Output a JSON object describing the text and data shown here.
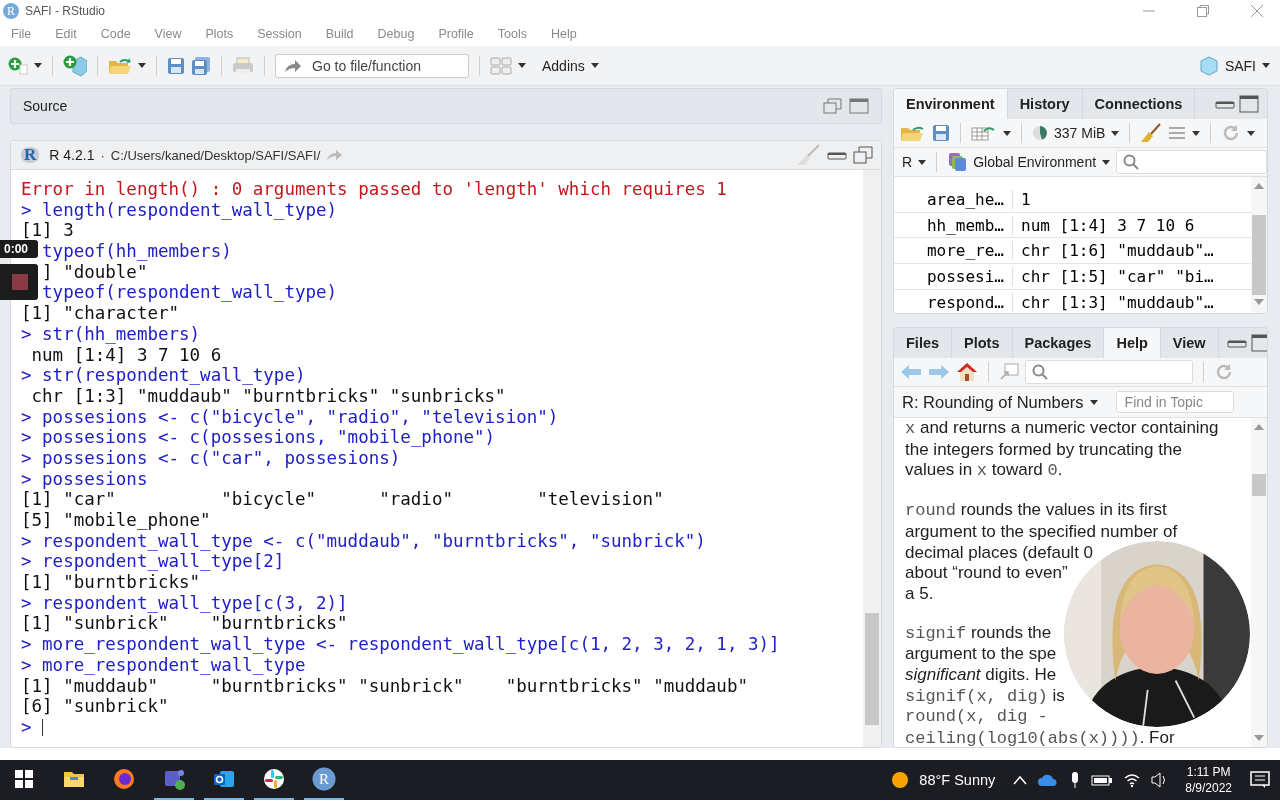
{
  "window": {
    "logo_letter": "R",
    "title": "SAFI - RStudio"
  },
  "menu": [
    "File",
    "Edit",
    "Code",
    "View",
    "Plots",
    "Session",
    "Build",
    "Debug",
    "Profile",
    "Tools",
    "Help"
  ],
  "toolbar": {
    "go_to_placeholder": "Go to file/function",
    "addins": "Addins",
    "project": "SAFI"
  },
  "source_pane": {
    "title": "Source"
  },
  "console": {
    "logo_letter": "R",
    "version": "R 4.2.1",
    "separator": "·",
    "path": "C:/Users/kaned/Desktop/SAFI/SAFI/",
    "lines": [
      {
        "kind": "error",
        "text": "Error in length() : 0 arguments passed to 'length' which requires 1"
      },
      {
        "kind": "input",
        "prompt": ">",
        "text": "length(respondent_wall_type)"
      },
      {
        "kind": "output",
        "text": "[1] 3"
      },
      {
        "kind": "input",
        "text": "typeof(hh_members)"
      },
      {
        "kind": "output_covered",
        "text": "] \"double\""
      },
      {
        "kind": "input",
        "text": "typeof(respondent_wall_type)"
      },
      {
        "kind": "output",
        "text": "[1] \"character\""
      },
      {
        "kind": "input",
        "prompt": ">",
        "text": "str(hh_members)"
      },
      {
        "kind": "output",
        "text": " num [1:4] 3 7 10 6"
      },
      {
        "kind": "input",
        "prompt": ">",
        "text": "str(respondent_wall_type)"
      },
      {
        "kind": "output",
        "text": " chr [1:3] \"muddaub\" \"burntbricks\" \"sunbricks\""
      },
      {
        "kind": "input",
        "prompt": ">",
        "text": "possesions <- c(\"bicycle\", \"radio\", \"television\")"
      },
      {
        "kind": "input",
        "prompt": ">",
        "text": "possesions <- c(possesions, \"mobile_phone\")"
      },
      {
        "kind": "input",
        "prompt": ">",
        "text": "possesions <- c(\"car\", possesions)"
      },
      {
        "kind": "input",
        "prompt": ">",
        "text": "possesions"
      },
      {
        "kind": "output",
        "text": "[1] \"car\"          \"bicycle\"      \"radio\"        \"television\""
      },
      {
        "kind": "output",
        "text": "[5] \"mobile_phone\""
      },
      {
        "kind": "input",
        "prompt": ">",
        "text": "respondent_wall_type <- c(\"muddaub\", \"burntbricks\", \"sunbrick\")"
      },
      {
        "kind": "input",
        "prompt": ">",
        "text": "respondent_wall_type[2]"
      },
      {
        "kind": "output",
        "text": "[1] \"burntbricks\""
      },
      {
        "kind": "input",
        "prompt": ">",
        "text": "respondent_wall_type[c(3, 2)]"
      },
      {
        "kind": "output",
        "text": "[1] \"sunbrick\"    \"burntbricks\""
      },
      {
        "kind": "input",
        "prompt": ">",
        "text": "more_respondent_wall_type <- respondent_wall_type[c(1, 2, 3, 2, 1, 3)]"
      },
      {
        "kind": "input",
        "prompt": ">",
        "text": "more_respondent_wall_type"
      },
      {
        "kind": "output",
        "text": "[1] \"muddaub\"     \"burntbricks\" \"sunbrick\"    \"burntbricks\" \"muddaub\""
      },
      {
        "kind": "output",
        "text": "[6] \"sunbrick\""
      },
      {
        "kind": "cursor",
        "prompt": ">"
      }
    ]
  },
  "environment_pane": {
    "tabs": [
      {
        "label": "Environment",
        "selected": true
      },
      {
        "label": "History",
        "selected": false
      },
      {
        "label": "Connections",
        "selected": false
      }
    ],
    "memory": "337 MiB",
    "language": "R",
    "scope": "Global Environment",
    "rows": [
      {
        "name": "area_he…",
        "value": "1"
      },
      {
        "name": "hh_memb…",
        "value": "num [1:4] 3 7 10 6"
      },
      {
        "name": "more_re…",
        "value": "chr [1:6] \"muddaub\"…"
      },
      {
        "name": "possesi…",
        "value": "chr [1:5] \"car\" \"bi…"
      },
      {
        "name": "respond…",
        "value": "chr [1:3] \"muddaub\"…"
      }
    ]
  },
  "help_pane": {
    "tabs": [
      {
        "label": "Files",
        "selected": false
      },
      {
        "label": "Plots",
        "selected": false
      },
      {
        "label": "Packages",
        "selected": false
      },
      {
        "label": "Help",
        "selected": true
      },
      {
        "label": "View",
        "selected": false
      }
    ],
    "topic": "R: Rounding of Numbers",
    "find_placeholder": "Find in Topic",
    "paragraphs": [
      [
        [
          {
            "text": "x",
            "code": true
          },
          {
            "text": " and returns a numeric vector containing"
          }
        ],
        [
          {
            "text": "the integers formed by truncating the"
          }
        ],
        [
          {
            "text": "values in "
          },
          {
            "text": "x",
            "code": true
          },
          {
            "text": " toward "
          },
          {
            "text": "0",
            "code": true
          },
          {
            "text": "."
          }
        ]
      ],
      [
        [
          {
            "text": "round",
            "code": true
          },
          {
            "text": " rounds the values in its first"
          }
        ],
        [
          {
            "text": "argument to the specified number of"
          }
        ],
        [
          {
            "text": "decimal places (default 0"
          }
        ],
        [
          {
            "text": "about “round to even”"
          }
        ],
        [
          {
            "text": "a 5."
          }
        ]
      ],
      [
        [
          {
            "text": "signif",
            "code": true
          },
          {
            "text": " rounds the"
          }
        ],
        [
          {
            "text": "argument to the spe"
          }
        ],
        [
          {
            "text": "*significant* digits. He"
          }
        ],
        [
          {
            "text": "signif(x, dig)",
            "code": true
          },
          {
            "text": " is"
          }
        ],
        [
          {
            "text": "round(x, dig -",
            "code": true
          }
        ],
        [
          {
            "text": "ceiling(log10(abs(x))))",
            "code": true
          },
          {
            "text": ". For"
          }
        ]
      ]
    ]
  },
  "recording": {
    "time": "0:00"
  },
  "taskbar": {
    "apps": [
      {
        "kind": "start",
        "open": false
      },
      {
        "kind": "files",
        "open": false
      },
      {
        "kind": "firefox",
        "open": false
      },
      {
        "kind": "teams",
        "open": true
      },
      {
        "kind": "outlook",
        "open": true
      },
      {
        "kind": "slack",
        "open": true
      },
      {
        "kind": "r",
        "label": "R",
        "open": true
      }
    ],
    "weather": "88°F Sunny",
    "time": "1:11 PM",
    "date": "8/9/2022"
  }
}
